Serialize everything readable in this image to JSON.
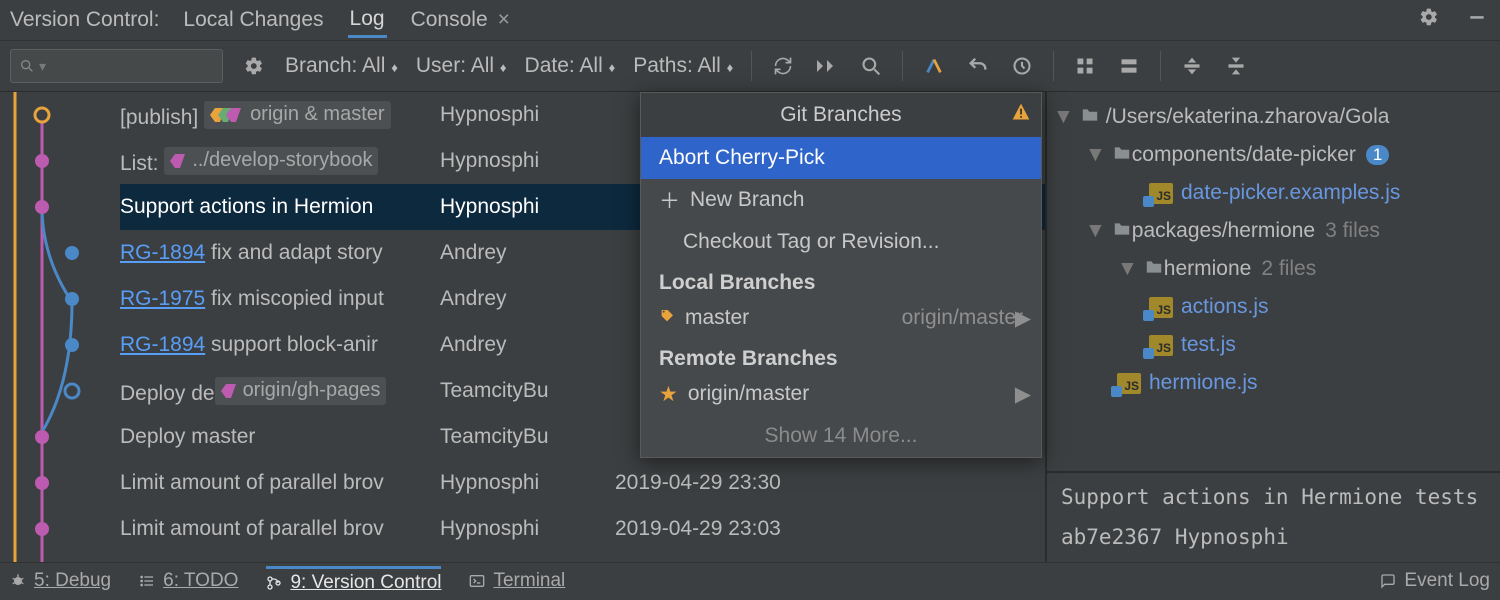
{
  "header": {
    "title": "Version Control:",
    "tabs": [
      "Local Changes",
      "Log",
      "Console"
    ],
    "active_tab": 1
  },
  "toolbar": {
    "search_placeholder": "",
    "filters": {
      "branch": "Branch: All",
      "user": "User: All",
      "date": "Date: All",
      "paths": "Paths: All"
    }
  },
  "commits": [
    {
      "msg_prefix": "[publish] ",
      "tag_label": "origin & master",
      "tag_style": "multi",
      "msg": " ",
      "author": "Hypnosphi",
      "date": ""
    },
    {
      "msg_prefix": "List: ",
      "tag_label": "../develop-storybook",
      "tag_style": "purple",
      "msg": " ",
      "author": "Hypnosphi",
      "date": ""
    },
    {
      "msg_prefix": "Support actions in Hermion",
      "tag_label": "",
      "tag_style": "",
      "msg": "",
      "author": "Hypnosphi",
      "date": "",
      "selected": true
    },
    {
      "link": "RG-1894",
      "msg": " fix and adapt story",
      "author": "Andrey",
      "date": ""
    },
    {
      "link": "RG-1975",
      "msg": " fix miscopied input",
      "author": "Andrey",
      "date": ""
    },
    {
      "link": "RG-1894",
      "msg": " support block-anir",
      "author": "Andrey",
      "date": ""
    },
    {
      "msg_prefix": "Deploy de",
      "tag_label": "origin/gh-pages",
      "tag_style": "purple",
      "msg": " ",
      "author": "TeamcityBu",
      "date": ""
    },
    {
      "msg_prefix": "Deploy master",
      "msg": "",
      "author": "TeamcityBu",
      "date": ""
    },
    {
      "msg_prefix": "Limit amount of parallel brov",
      "msg": "",
      "author": "Hypnosphi",
      "date": "2019-04-29 23:30"
    },
    {
      "msg_prefix": "Limit amount of parallel brov",
      "msg": "",
      "author": "Hypnosphi",
      "date": "2019-04-29 23:03"
    }
  ],
  "popup": {
    "title": "Git Branches",
    "items": [
      {
        "label": "Abort Cherry-Pick",
        "selected": true
      },
      {
        "icon": "plus",
        "label": "New Branch"
      },
      {
        "label": "Checkout Tag or Revision..."
      }
    ],
    "local_title": "Local Branches",
    "local": [
      {
        "icon": "tag",
        "label": "master",
        "sub": "origin/master",
        "arrow": true
      }
    ],
    "remote_title": "Remote Branches",
    "remote": [
      {
        "icon": "star",
        "label": "origin/master",
        "arrow": true
      }
    ],
    "more": "Show 14 More..."
  },
  "tree": {
    "root": "/Users/ekaterina.zharova/Gola",
    "nodes": [
      {
        "indent": 1,
        "type": "folder",
        "name": "components/date-picker",
        "badge": "1"
      },
      {
        "indent": 3,
        "type": "js",
        "name": "date-picker.examples.js",
        "mod": true
      },
      {
        "indent": 1,
        "type": "folder",
        "name": "packages/hermione",
        "meta": "3 files"
      },
      {
        "indent": 2,
        "type": "folder",
        "name": "hermione",
        "meta": "2 files"
      },
      {
        "indent": 3,
        "type": "js",
        "name": "actions.js",
        "mod": true
      },
      {
        "indent": 3,
        "type": "js",
        "name": "test.js",
        "mod": true
      },
      {
        "indent": 2,
        "type": "js",
        "name": "hermione.js",
        "mod": true
      }
    ]
  },
  "detail": {
    "title": "Support actions in Hermione tests",
    "hash": "ab7e2367",
    "author": "Hypnosphi"
  },
  "status": {
    "tabs": [
      {
        "icon": "bug",
        "label": "5: Debug"
      },
      {
        "icon": "list",
        "label": "6: TODO"
      },
      {
        "icon": "branch",
        "label": "9: Version Control",
        "active": true
      },
      {
        "icon": "terminal",
        "label": "Terminal"
      }
    ],
    "eventlog": "Event Log"
  }
}
